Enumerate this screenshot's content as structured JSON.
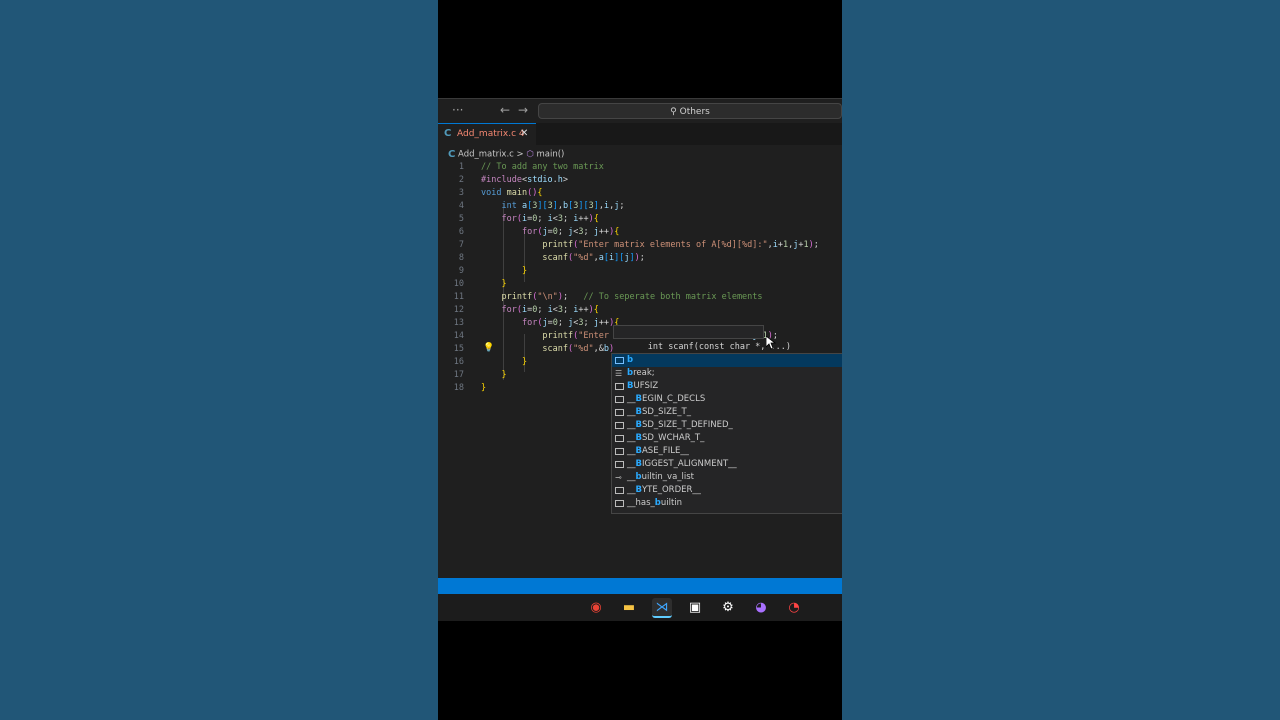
{
  "titlebar": {
    "more": "···",
    "back": "←",
    "forward": "→",
    "search_text": "Others"
  },
  "tab": {
    "label": "Add_matrix.c 4",
    "close": "✕",
    "icon": "C"
  },
  "breadcrumb": {
    "file": "Add_matrix.c",
    "sep": ">",
    "symbol": "main()"
  },
  "code": [
    {
      "n": "1",
      "t": "// To add any two matrix"
    },
    {
      "n": "2",
      "t": "#include<stdio.h>"
    },
    {
      "n": "3",
      "t": "void main(){"
    },
    {
      "n": "4",
      "t": "    int a[3][3],b[3][3],i,j;"
    },
    {
      "n": "5",
      "t": "    for(i=0; i<3; i++){"
    },
    {
      "n": "6",
      "t": "        for(j=0; j<3; j++){"
    },
    {
      "n": "7",
      "t": "            printf(\"Enter matrix elements of A[%d][%d]:\",i+1,j+1);"
    },
    {
      "n": "8",
      "t": "            scanf(\"%d\",a[i][j]);"
    },
    {
      "n": "9",
      "t": "        }"
    },
    {
      "n": "10",
      "t": "    }"
    },
    {
      "n": "11",
      "t": "    printf(\"\\n\");   // To seperate both matrix elements"
    },
    {
      "n": "12",
      "t": "    for(i=0; i<3; i++){"
    },
    {
      "n": "13",
      "t": "        for(j=0; j<3; j++){"
    },
    {
      "n": "14",
      "t": "            printf(\"Enter                    :\",i+1; j+1);"
    },
    {
      "n": "15",
      "t": "            scanf(\"%d\",&b)"
    },
    {
      "n": "16",
      "t": "        }"
    },
    {
      "n": "17",
      "t": "    }"
    },
    {
      "n": "18",
      "t": "}"
    }
  ],
  "signature_hint": "int scanf(const char *, ...)",
  "suggestions": [
    {
      "label": "b",
      "icon": "var-icon",
      "selected": true
    },
    {
      "label": "break;",
      "icon": "snippet-icon"
    },
    {
      "label": "BUFSIZ",
      "icon": "constant-icon"
    },
    {
      "label": "__BEGIN_C_DECLS",
      "icon": "constant-icon"
    },
    {
      "label": "__BSD_SIZE_T_",
      "icon": "constant-icon"
    },
    {
      "label": "__BSD_SIZE_T_DEFINED_",
      "icon": "constant-icon"
    },
    {
      "label": "__BSD_WCHAR_T_",
      "icon": "constant-icon"
    },
    {
      "label": "__BASE_FILE__",
      "icon": "constant-icon"
    },
    {
      "label": "__BIGGEST_ALIGNMENT__",
      "icon": "constant-icon"
    },
    {
      "label": "__builtin_va_list",
      "icon": "type-icon"
    },
    {
      "label": "__BYTE_ORDER__",
      "icon": "constant-icon"
    },
    {
      "label": "__has_builtin",
      "icon": "constant-icon"
    }
  ],
  "taskbar": [
    {
      "name": "chrome-icon",
      "glyph": "◉",
      "color": "#ea4335"
    },
    {
      "name": "file-explorer-icon",
      "glyph": "▬",
      "color": "#f6c344"
    },
    {
      "name": "vscode-icon",
      "glyph": "⋊",
      "color": "#3ea6ff",
      "active": true
    },
    {
      "name": "store-icon",
      "glyph": "▣",
      "color": "#ffffff"
    },
    {
      "name": "settings-icon",
      "glyph": "⚙",
      "color": "#ffffff"
    },
    {
      "name": "messenger-icon",
      "glyph": "◕",
      "color": "#a970ff"
    },
    {
      "name": "clock-icon",
      "glyph": "◔",
      "color": "#ff4444"
    }
  ]
}
